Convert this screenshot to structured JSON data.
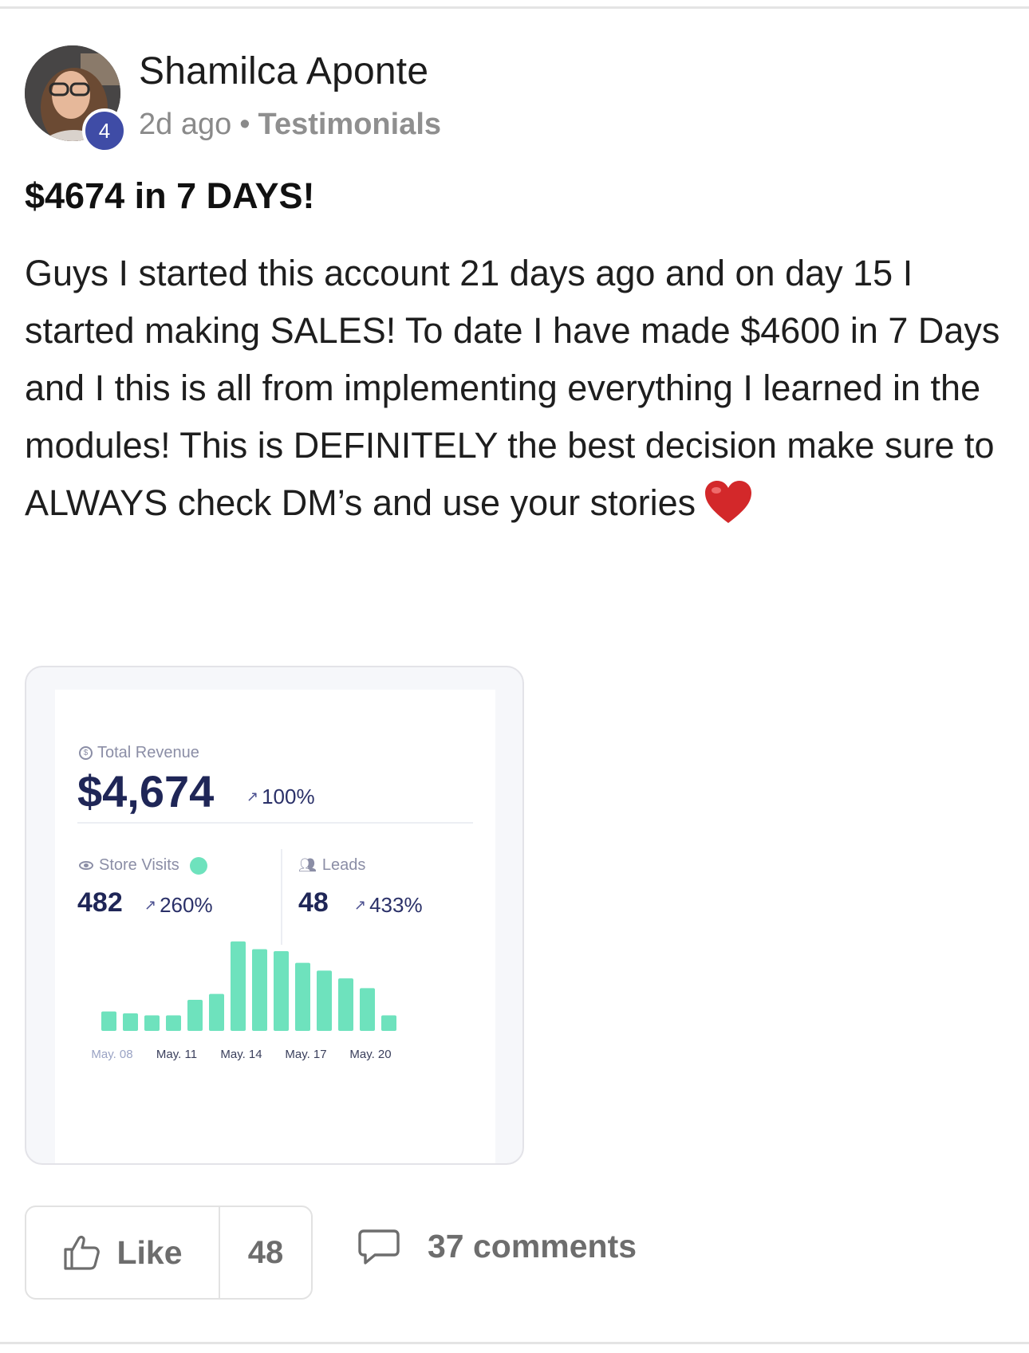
{
  "post": {
    "author": "Shamilca Aponte",
    "level": "4",
    "time": "2d ago",
    "separator": "•",
    "category": "Testimonials",
    "title": "$4674 in 7 DAYS!",
    "body": "Guys I started this account 21 days ago and on day 15 I started making SALES! To date I have made $4600 in 7 Days and I this is all from implementing everything I learned in the modules! This is DEFINITELY the best decision make sure to ALWAYS check DM’s and use your stories"
  },
  "screenshot": {
    "revenue_label": "Total Revenue",
    "revenue_value": "$4,674",
    "revenue_trend": "100%",
    "visits_label": "Store Visits",
    "visits_value": "482",
    "visits_trend": "260%",
    "leads_label": "Leads",
    "leads_value": "48",
    "leads_trend": "433%",
    "accent_color": "#6ee2bd"
  },
  "chart_data": {
    "type": "bar",
    "x_tick_labels": [
      "May. 08",
      "May. 11",
      "May. 14",
      "May. 17",
      "May. 20"
    ],
    "values": [
      1.0,
      0.9,
      0.8,
      0.8,
      1.6,
      1.9,
      4.6,
      4.2,
      4.1,
      3.5,
      3.1,
      2.7,
      2.2,
      0.8
    ],
    "ylim": [
      0,
      5
    ],
    "grid": false,
    "bar_color": "#6ee2bd"
  },
  "actions": {
    "like_label": "Like",
    "like_count": "48",
    "comments_label": "37 comments"
  }
}
